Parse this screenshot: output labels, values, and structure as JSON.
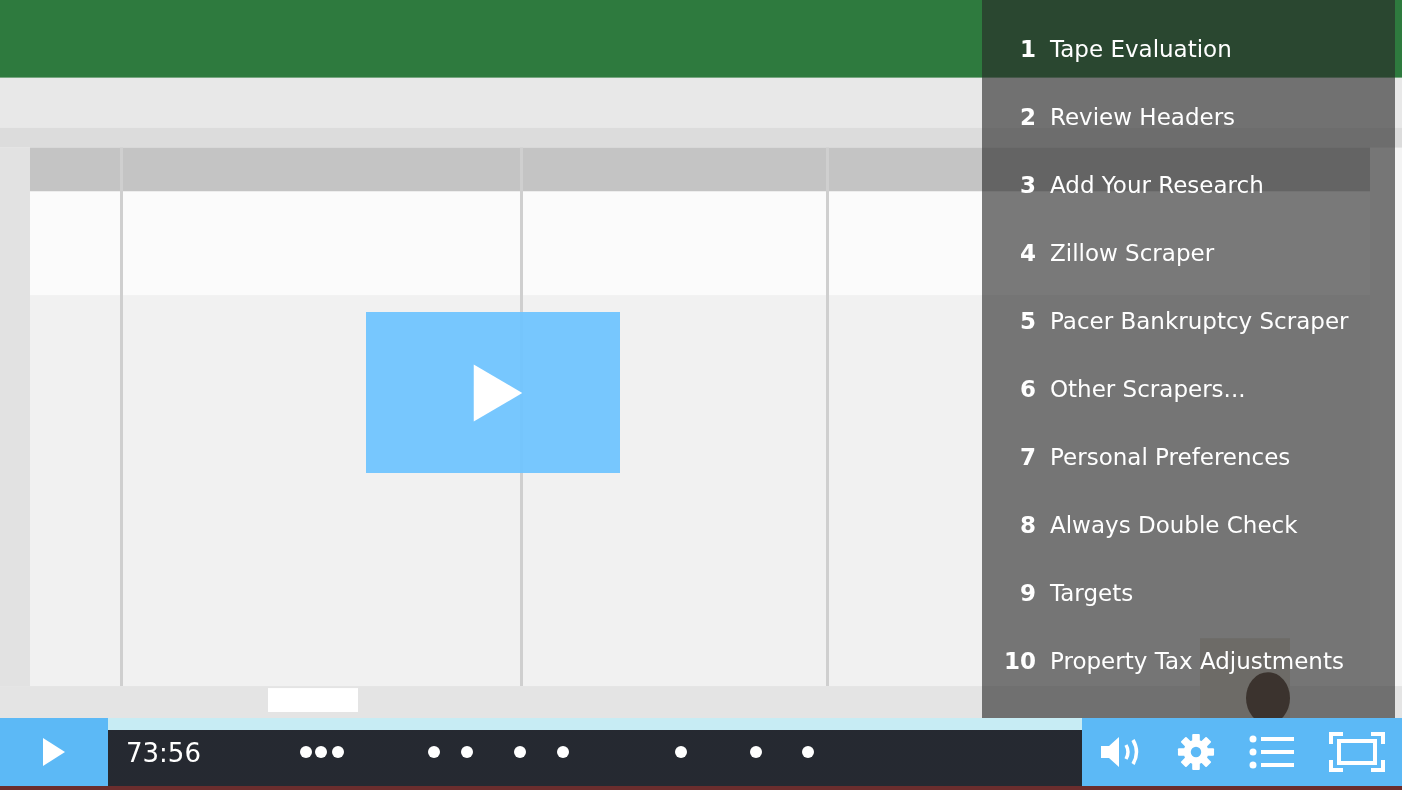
{
  "chapters": [
    {
      "number": "1",
      "title": "Tape Evaluation"
    },
    {
      "number": "2",
      "title": "Review Headers"
    },
    {
      "number": "3",
      "title": "Add Your Research"
    },
    {
      "number": "4",
      "title": "Zillow Scraper"
    },
    {
      "number": "5",
      "title": "Pacer Bankruptcy Scraper"
    },
    {
      "number": "6",
      "title": "Other Scrapers..."
    },
    {
      "number": "7",
      "title": "Personal Preferences"
    },
    {
      "number": "8",
      "title": "Always Double Check"
    },
    {
      "number": "9",
      "title": "Targets"
    },
    {
      "number": "10",
      "title": "Property Tax Adjustments"
    }
  ],
  "controls": {
    "time": "73:56"
  }
}
